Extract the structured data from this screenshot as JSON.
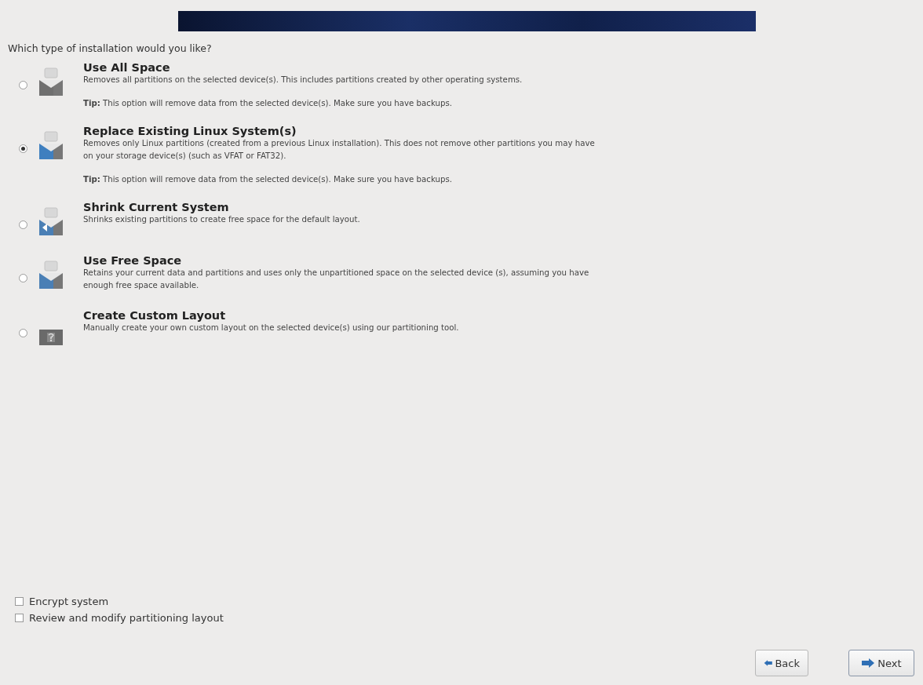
{
  "question": "Which type of installation would you like?",
  "options": [
    {
      "kind": "erase",
      "title": "Use All Space",
      "selected": false,
      "description": "Removes all partitions on the selected device(s).  This includes partitions created by other operating systems.",
      "tip": "**Tip:** This option will remove data from the selected device(s).  Make sure you have backups."
    },
    {
      "kind": "replace",
      "title": "Replace Existing Linux System(s)",
      "selected": true,
      "description": "Removes only Linux partitions (created from a previous Linux installation).  This does not remove other partitions you may have on your storage device(s) (such as VFAT or FAT32).",
      "tip": "**Tip:** This option will remove data from the selected device(s).  Make sure you have backups."
    },
    {
      "kind": "shrink",
      "title": "Shrink Current System",
      "selected": false,
      "description": "Shrinks existing partitions to create free space for the default layout."
    },
    {
      "kind": "free",
      "title": "Use Free Space",
      "selected": false,
      "description": "Retains your current data and partitions and uses only the unpartitioned space on the selected device (s), assuming you have enough free space available."
    },
    {
      "kind": "custom",
      "title": "Create Custom Layout",
      "selected": false,
      "description": "Manually create your own custom layout on the selected device(s) using our partitioning tool."
    }
  ],
  "checkboxes": [
    {
      "label": "Encrypt system",
      "checked": false
    },
    {
      "label": "Review and modify partitioning layout",
      "checked": false
    }
  ],
  "buttons": [
    {
      "kind": "back",
      "label": "Back"
    },
    {
      "kind": "next",
      "label": "Next"
    }
  ]
}
